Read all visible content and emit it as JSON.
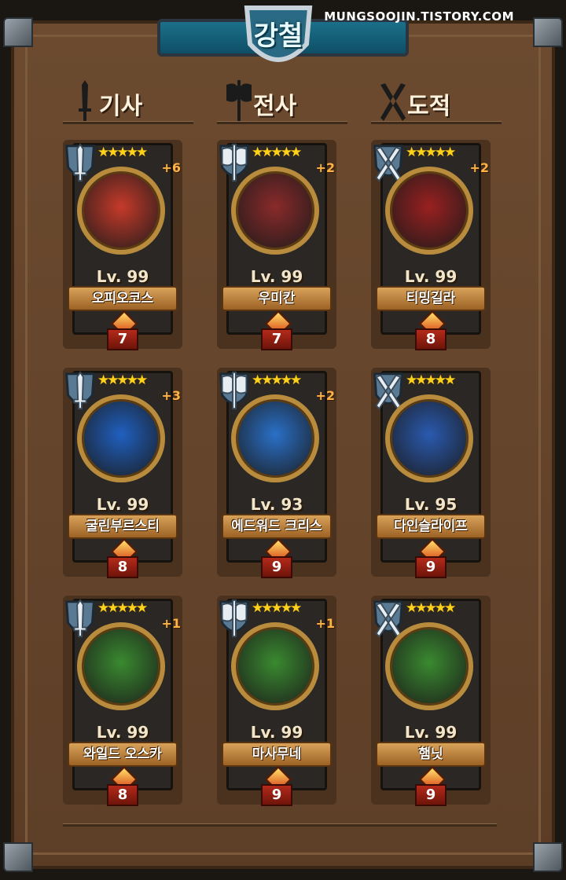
{
  "title": "강철",
  "watermark": "MUNGSOOJIN.TISTORY.COM",
  "categories": [
    {
      "label": "기사",
      "icon": "sword-icon"
    },
    {
      "label": "전사",
      "icon": "axe-icon"
    },
    {
      "label": "도적",
      "icon": "crossed-blades-icon"
    }
  ],
  "heroes": [
    {
      "name": "오피오코스",
      "level": "Lv. 99",
      "plus": "+6",
      "stars": "★★★★★",
      "grade": "7",
      "class_icon": "sword-icon",
      "color": "#c63a2a"
    },
    {
      "name": "우미칸",
      "level": "Lv. 99",
      "plus": "+2",
      "stars": "★★★★★",
      "grade": "7",
      "class_icon": "axe-icon",
      "color": "#8a2a2a"
    },
    {
      "name": "티밍길라",
      "level": "Lv. 99",
      "plus": "+2",
      "stars": "★★★★★",
      "grade": "8",
      "class_icon": "crossed-blades-icon",
      "color": "#9a2020"
    },
    {
      "name": "굴린부르스티",
      "level": "Lv. 99",
      "plus": "+3",
      "stars": "★★★★★",
      "grade": "8",
      "class_icon": "sword-icon",
      "color": "#2060c0"
    },
    {
      "name": "에드워드 크리스",
      "level": "Lv. 93",
      "plus": "+2",
      "stars": "★★★★★",
      "grade": "9",
      "class_icon": "axe-icon",
      "color": "#2a70c8"
    },
    {
      "name": "다인슬라이프",
      "level": "Lv. 95",
      "plus": "",
      "stars": "★★★★★",
      "grade": "9",
      "class_icon": "crossed-blades-icon",
      "color": "#2a5ab0"
    },
    {
      "name": "와일드 오스카",
      "level": "Lv. 99",
      "plus": "+1",
      "stars": "★★★★★",
      "grade": "8",
      "class_icon": "sword-icon",
      "color": "#3a8a30"
    },
    {
      "name": "마사무네",
      "level": "Lv. 99",
      "plus": "+1",
      "stars": "★★★★★",
      "grade": "9",
      "class_icon": "axe-icon",
      "color": "#3a8a30"
    },
    {
      "name": "햄닛",
      "level": "Lv. 99",
      "plus": "",
      "stars": "★★★★★",
      "grade": "9",
      "class_icon": "crossed-blades-icon",
      "color": "#3a8a30"
    }
  ]
}
